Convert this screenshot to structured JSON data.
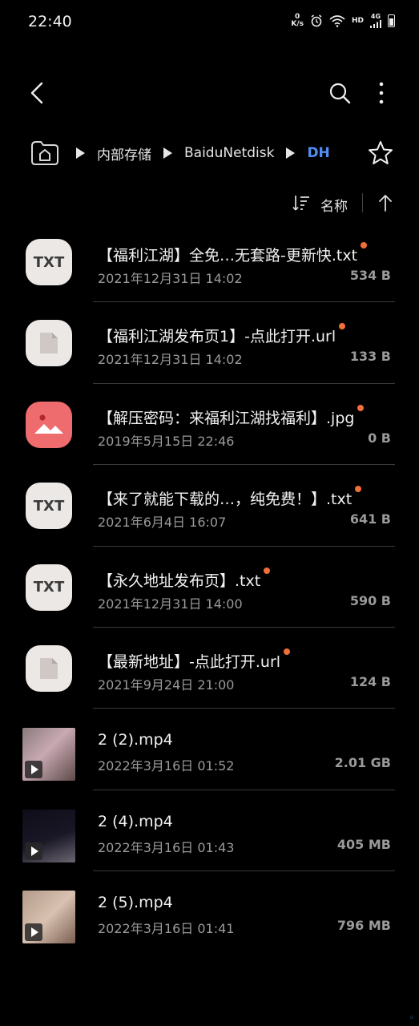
{
  "status_bar": {
    "time": "22:40",
    "net_speed_value": "0",
    "net_speed_unit": "K/s",
    "hd_label": "HD",
    "signal_label": "4G",
    "icons": [
      "alarm-icon",
      "wifi-icon",
      "signal-icon",
      "battery-icon"
    ]
  },
  "top_bar": {
    "icons": [
      "back-icon",
      "search-icon",
      "more-icon"
    ]
  },
  "breadcrumb": {
    "items": [
      {
        "label": "内部存储"
      },
      {
        "label": "BaiduNetdisk"
      },
      {
        "label": "DH"
      }
    ],
    "accent_color": "#4f8ff7"
  },
  "sort": {
    "label": "名称"
  },
  "files": [
    {
      "name": "【福利江湖】全免…无套路-更新快.txt",
      "date": "2021年12月31日 14:02",
      "size": "534 B",
      "type": "txt",
      "icon_text": "TXT",
      "new": true
    },
    {
      "name": "【福利江湖发布页1】-点此打开.url",
      "date": "2021年12月31日 14:02",
      "size": "133 B",
      "type": "doc",
      "new": true
    },
    {
      "name": "【解压密码：来福利江湖找福利】.jpg",
      "date": "2019年5月15日 22:46",
      "size": "0 B",
      "type": "image",
      "new": true
    },
    {
      "name": "【来了就能下载的…，纯免费！】.txt",
      "date": "2021年6月4日 16:07",
      "size": "641 B",
      "type": "txt",
      "icon_text": "TXT",
      "new": true
    },
    {
      "name": "【永久地址发布页】.txt",
      "date": "2021年12月31日 14:00",
      "size": "590 B",
      "type": "txt",
      "icon_text": "TXT",
      "new": true
    },
    {
      "name": "【最新地址】-点此打开.url",
      "date": "2021年9月24日 21:00",
      "size": "124 B",
      "type": "doc",
      "new": true
    },
    {
      "name": "2 (2).mp4",
      "date": "2022年3月16日 01:52",
      "size": "2.01 GB",
      "type": "video",
      "new": false
    },
    {
      "name": "2 (4).mp4",
      "date": "2022年3月16日 01:43",
      "size": "405 MB",
      "type": "video",
      "new": false
    },
    {
      "name": "2 (5).mp4",
      "date": "2022年3月16日 01:41",
      "size": "796 MB",
      "type": "video",
      "new": false
    }
  ],
  "colors": {
    "new_dot": "#f07038",
    "image_icon": "#ee6b6e"
  }
}
